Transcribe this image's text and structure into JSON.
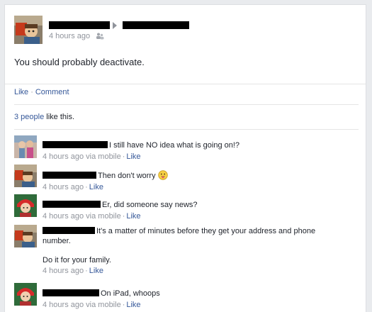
{
  "post": {
    "time": "4 hours ago",
    "audience_icon": "friends-icon",
    "text": "You should probably deactivate."
  },
  "actions": {
    "like": "Like",
    "separator": "·",
    "comment": "Comment"
  },
  "likes": {
    "count_link": "3 people",
    "suffix": " like this."
  },
  "comments": [
    {
      "text": "I still have NO idea what is going on!?",
      "time": "4 hours ago",
      "via": " via mobile",
      "like": "Like"
    },
    {
      "text": "Then don't worry",
      "time": "4 hours ago",
      "via": "",
      "like": "Like"
    },
    {
      "text": "Er, did someone say news?",
      "time": "4 hours ago",
      "via": " via mobile",
      "like": "Like"
    },
    {
      "text": "It's a matter of minutes before they get your address and phone",
      "text2": "number.",
      "extra": "Do it for your family.",
      "time": "4 hours ago",
      "via": "",
      "like": "Like"
    },
    {
      "text": "On iPad, whoops",
      "time": "4 hours ago",
      "via": " via mobile",
      "like": "Like"
    }
  ]
}
